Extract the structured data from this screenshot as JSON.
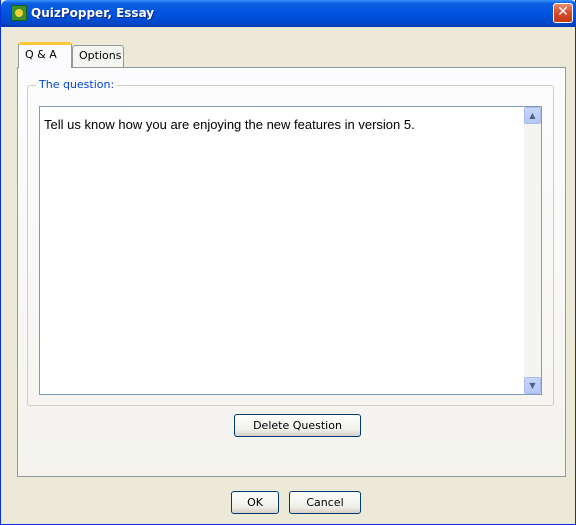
{
  "window": {
    "title": "QuizPopper, Essay",
    "app_icon": "quizpopper-app-icon",
    "close_icon": "close-icon",
    "close_glyph": "✕"
  },
  "tabs": [
    {
      "label": "Q & A",
      "active": true
    },
    {
      "label": "Options",
      "active": false
    }
  ],
  "question_group": {
    "legend": "The question:",
    "text": "Tell us know how you are enjoying the new features in version 5."
  },
  "scrollbar": {
    "up_icon": "scroll-up-arrow-icon",
    "down_icon": "scroll-down-arrow-icon",
    "up_glyph": "▲",
    "down_glyph": "▼"
  },
  "buttons": {
    "delete_question": "Delete Question",
    "ok": "OK",
    "cancel": "Cancel"
  },
  "colors": {
    "titlebar": "#0053e1",
    "dialog_background": "#ece9d8",
    "legend_text": "#0046d5",
    "active_tab_accent": "#ffc83c",
    "close_button": "#d24b2b"
  }
}
